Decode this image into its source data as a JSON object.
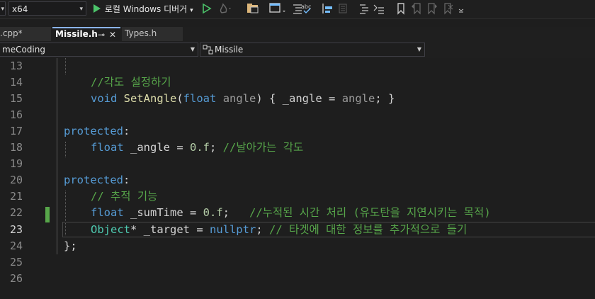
{
  "toolbar": {
    "platform_value": "x64",
    "debugger_label": "로컬 Windows 디버거"
  },
  "tabs": [
    {
      "label": ".cpp*"
    },
    {
      "label": "Missile.h"
    },
    {
      "label": "Types.h"
    }
  ],
  "navbar": {
    "project": "meCoding",
    "scope": "Missile"
  },
  "editor": {
    "lines": [
      {
        "n": "13"
      },
      {
        "n": "14",
        "comment": "//각도 설정하기"
      },
      {
        "n": "15",
        "kw": "void",
        "fn": "SetAngle",
        "p1": "(",
        "kw2": "float",
        "param": "angle",
        "rest": ") { _angle = ",
        "param2": "angle",
        "end": "; }"
      },
      {
        "n": "16"
      },
      {
        "n": "17",
        "kw": "protected",
        "end": ":"
      },
      {
        "n": "18",
        "kw": "float",
        "id": " _angle = ",
        "num": "0.f",
        "end": "; ",
        "comment": "//날아가는 각도"
      },
      {
        "n": "19"
      },
      {
        "n": "20",
        "kw": "protected",
        "end": ":"
      },
      {
        "n": "21",
        "comment": "// 추적 기능"
      },
      {
        "n": "22",
        "kw": "float",
        "id": " _sumTime = ",
        "num": "0.f",
        "end": ";   ",
        "comment": "//누적된 시간 처리 (유도탄을 지연시키는 목적)"
      },
      {
        "n": "23",
        "ty": "Object",
        "id": "* _target = ",
        "kw": "nullptr",
        "end": "; ",
        "comment": "// 타겟에 대한 정보를 추가적으로 들기"
      },
      {
        "n": "24",
        "id": "};"
      },
      {
        "n": "25"
      },
      {
        "n": "26"
      }
    ]
  },
  "colors": {
    "keyword": "#569cd6",
    "comment": "#57a64a",
    "type": "#4ec9b0",
    "function": "#dcdcaa",
    "number": "#b5cea8"
  }
}
